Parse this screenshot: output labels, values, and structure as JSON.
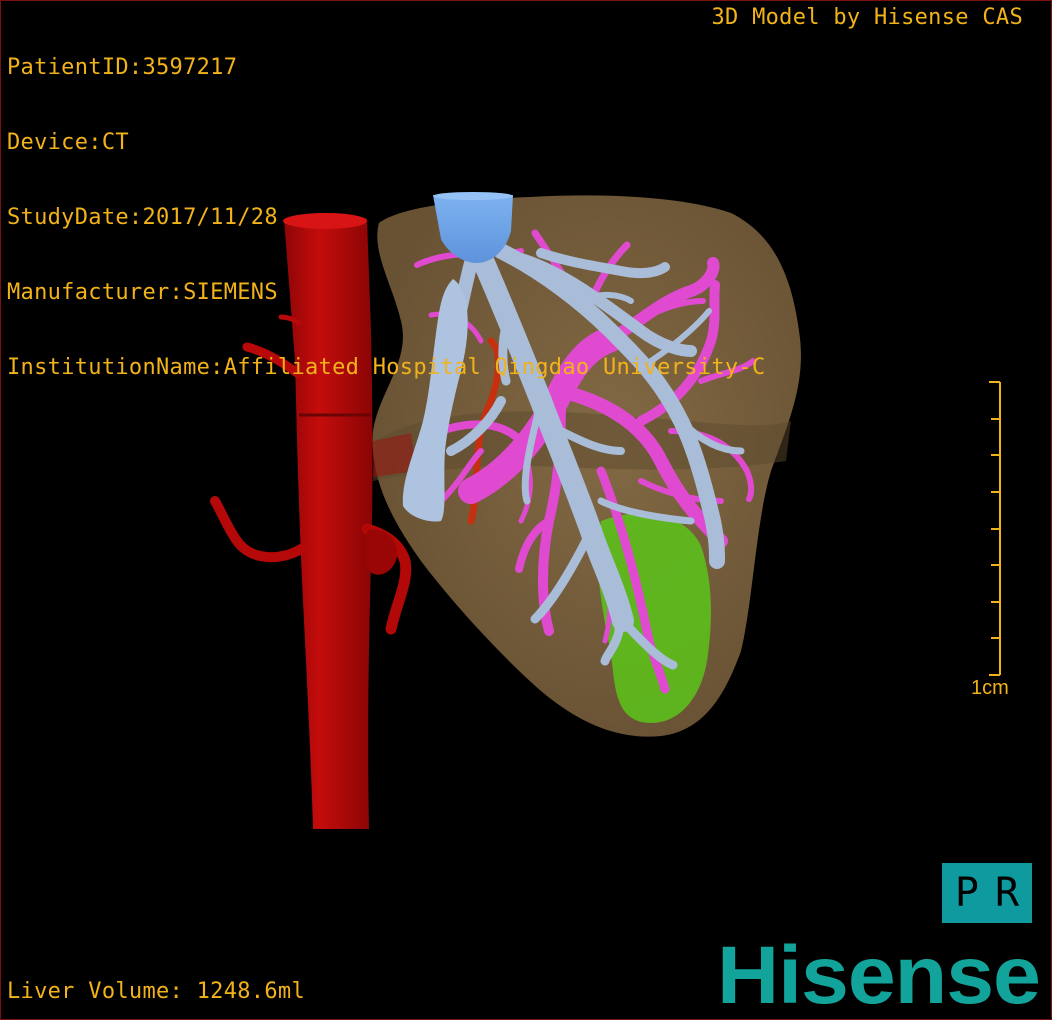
{
  "study_info": {
    "patient_id": "PatientID:3597217",
    "device": "Device:CT",
    "study_date": "StudyDate:2017/11/28",
    "manufacturer": "Manufacturer:SIEMENS",
    "institution": "InstitutionName:Affiliated Hospital Qingdao University-C"
  },
  "model_label": "3D Model by Hisense CAS",
  "liver_volume": "Liver Volume: 1248.6ml",
  "scale_bar": {
    "label": "1cm"
  },
  "orientation": {
    "left": "P",
    "right": "R"
  },
  "brand": "Hisense",
  "colors": {
    "overlay_text": "#f2b21a",
    "liver": "#7a6240",
    "artery": "#c00a0a",
    "portal_vein": "#e04ad0",
    "hepatic_vein": "#a9bcd8",
    "ivc_cap": "#6fa4e8",
    "gallbladder": "#5dbf1c",
    "brand": "#12a49a",
    "orientation_box": "#0f9aa0"
  }
}
